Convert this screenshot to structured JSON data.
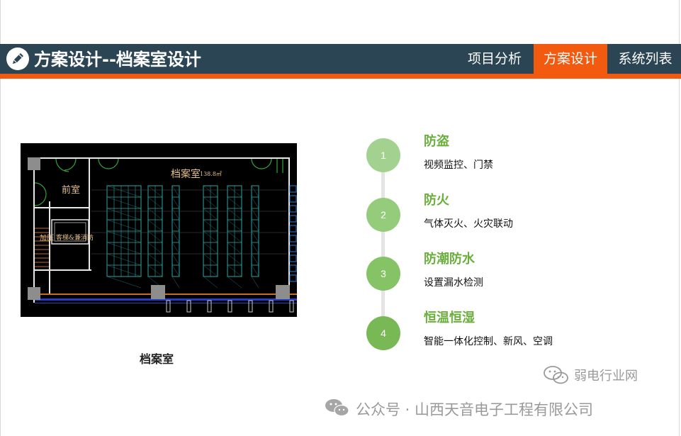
{
  "header": {
    "title": "方案设计--档案室设计",
    "logo_icon": "pencil-icon",
    "nav": [
      {
        "label": "项目分析",
        "active": false
      },
      {
        "label": "方案设计",
        "active": true
      },
      {
        "label": "系统列表",
        "active": false
      }
    ]
  },
  "plan": {
    "room_label": "档案室",
    "room_area": "138.8㎡",
    "front_room_label": "前室",
    "side_label": "加压",
    "lift_label": "客梯&兼消防",
    "caption": "档案室"
  },
  "features": [
    {
      "number": "1",
      "title": "防盗",
      "desc": "视频监控、门禁"
    },
    {
      "number": "2",
      "title": "防火",
      "desc": "气体灭火、火灾联动"
    },
    {
      "number": "3",
      "title": "防潮防水",
      "desc": "设置漏水检测"
    },
    {
      "number": "4",
      "title": "恒温恒湿",
      "desc": "智能一体化控制、新风、空调"
    }
  ],
  "watermark": {
    "site": "弱电行业网",
    "account": "公众号 · 山西天音电子工程有限公司",
    "icon": "wechat-icon"
  },
  "colors": {
    "header_bg": "#2b4555",
    "accent": "#f15a0f",
    "feature_title": "#6aae3c",
    "timeline_line": "#e4e4e4"
  }
}
